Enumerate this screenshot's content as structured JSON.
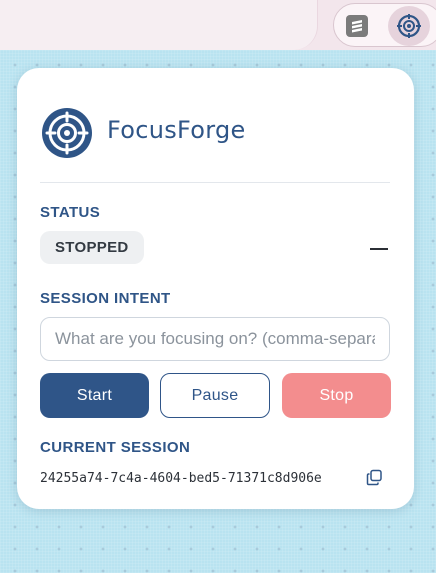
{
  "app": {
    "name": "FocusForge"
  },
  "status": {
    "label": "STATUS",
    "value": "STOPPED"
  },
  "intent": {
    "label": "SESSION INTENT",
    "placeholder": "What are you focusing on? (comma-separated)",
    "value": ""
  },
  "controls": {
    "start_label": "Start",
    "pause_label": "Pause",
    "stop_label": "Stop"
  },
  "session": {
    "label": "CURRENT SESSION",
    "id": "24255a74-7c4a-4604-bed5-71371c8d906e"
  },
  "colors": {
    "brand": "#2f5587",
    "stop": "#f38d8e",
    "page_background": "#b9e3f0"
  },
  "icons": {
    "extension_1": "stacked-bars-icon",
    "extension_2": "target-icon",
    "logo": "target-logo-icon",
    "copy": "copy-icon"
  }
}
